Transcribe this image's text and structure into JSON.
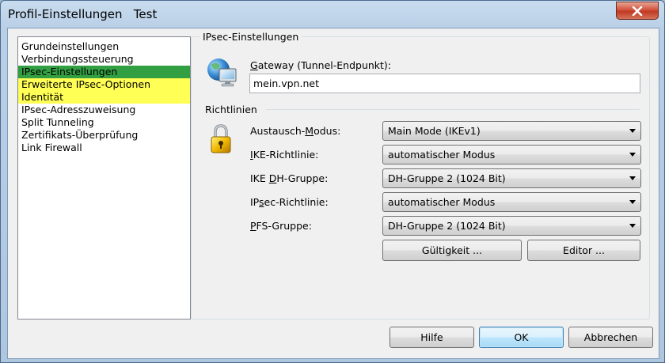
{
  "window": {
    "title": "Profil-Einstellungen   Test",
    "close_glyph": "✕"
  },
  "nav": {
    "items": [
      {
        "label": "Grundeinstellungen",
        "highlight": "none"
      },
      {
        "label": "Verbindungssteuerung",
        "highlight": "none"
      },
      {
        "label": "IPsec-Einstellungen",
        "highlight": "green"
      },
      {
        "label": "Erweiterte IPsec-Optionen",
        "highlight": "yellow"
      },
      {
        "label": "Identität",
        "highlight": "yellow"
      },
      {
        "label": "IPsec-Adresszuweisung",
        "highlight": "none"
      },
      {
        "label": "Split Tunneling",
        "highlight": "none"
      },
      {
        "label": "Zertifikats-Überprüfung",
        "highlight": "none"
      },
      {
        "label": "Link Firewall",
        "highlight": "none"
      }
    ]
  },
  "ipsec": {
    "group_title": "IPsec-Einstellungen",
    "gateway_label_ul": "G",
    "gateway_label_rest": "ateway (Tunnel-Endpunkt):",
    "gateway_value": "mein.vpn.net",
    "gateway_icon": "network-globe-icon"
  },
  "policies": {
    "section_title": "Richtlinien",
    "lock_icon": "padlock-icon",
    "rows": [
      {
        "label_pre": "Austausch-",
        "label_ul": "M",
        "label_post": "odus:",
        "value": "Main Mode (IKEv1)"
      },
      {
        "label_pre": "",
        "label_ul": "I",
        "label_post": "KE-Richtlinie:",
        "value": "automatischer Modus"
      },
      {
        "label_pre": "IKE ",
        "label_ul": "D",
        "label_post": "H-Gruppe:",
        "value": "DH-Gruppe 2 (1024 Bit)"
      },
      {
        "label_pre": "IP",
        "label_ul": "s",
        "label_post": "ec-Richtlinie:",
        "value": "automatischer Modus"
      },
      {
        "label_pre": "",
        "label_ul": "P",
        "label_post": "FS-Gruppe:",
        "value": "DH-Gruppe 2 (1024 Bit)"
      }
    ],
    "validity_button": "Gültigkeit ...",
    "editor_button": "Editor ..."
  },
  "footer": {
    "help_button": "Hilfe",
    "ok_button": "OK",
    "cancel_button": "Abbrechen"
  },
  "colors": {
    "highlight_yellow": "#ffff55",
    "highlight_green": "#32a042",
    "close_red": "#c03a22"
  }
}
